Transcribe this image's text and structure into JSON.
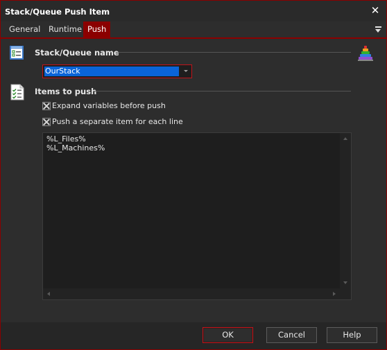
{
  "window": {
    "title": "Stack/Queue Push Item",
    "close_glyph": "✕"
  },
  "tabs": [
    {
      "label": "General",
      "active": false
    },
    {
      "label": "Runtime",
      "active": false
    },
    {
      "label": "Push",
      "active": true
    }
  ],
  "stack_section": {
    "label": "Stack/Queue name",
    "icon": "stack-list-icon",
    "side_icon": "pyramid-stack-icon",
    "selected_value": "OurStack"
  },
  "items_section": {
    "label": "Items to push",
    "icon": "document-checklist-icon",
    "expand_variables": {
      "label": "Expand variables before push",
      "checked": true
    },
    "separate_items": {
      "label": "Push a separate item for each line",
      "checked": true
    },
    "text": "%L_Files%\n%L_Machines%"
  },
  "buttons": {
    "ok": "OK",
    "cancel": "Cancel",
    "help": "Help"
  },
  "colors": {
    "accent": "#8b0000",
    "selection": "#0a64d8",
    "background": "#2d2d2d"
  }
}
